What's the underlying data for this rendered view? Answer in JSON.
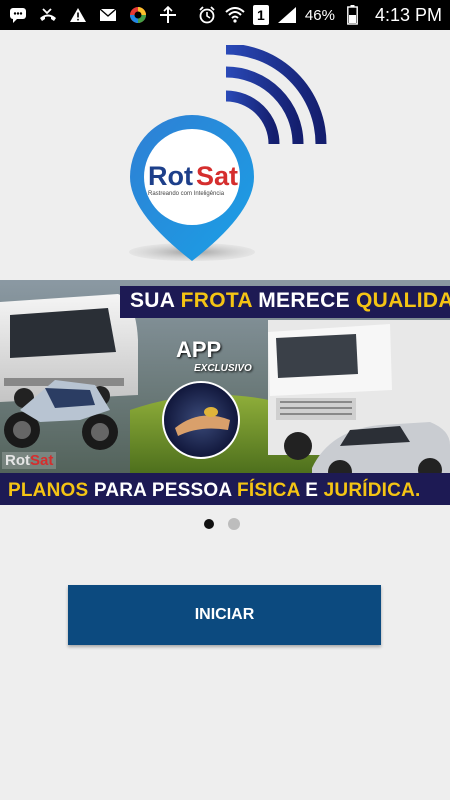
{
  "status_bar": {
    "battery_percent": "46%",
    "time": "4:13 PM",
    "sim_slot": "1",
    "icons": [
      "chat-icon",
      "missed-call-icon",
      "warning-icon",
      "mail-icon",
      "color-wheel-icon",
      "sync-icon",
      "alarm-icon",
      "wifi-icon",
      "sim-icon",
      "signal-icon",
      "battery-icon"
    ]
  },
  "logo": {
    "brand_part1": "Rot",
    "brand_part2": "Sat",
    "tagline": "Rastreando com Inteligência",
    "colors": {
      "pin": "#1f88d9",
      "waves": "#1b2a86",
      "text_dark": "#1d3f8a",
      "text_red": "#d52e2e"
    }
  },
  "banner": {
    "headline_part1": "SUA",
    "headline_part2": "FROTA",
    "headline_part3": "MERECE",
    "headline_part4": "QUALIDADE!",
    "app_label": "APP",
    "app_sub": "EXCLUSIVO",
    "footer_part1": "PLANOS",
    "footer_part2": "PARA PESSOA",
    "footer_part3": "FÍSICA",
    "footer_part4": "E",
    "footer_part5": "JURÍDICA.",
    "watermark_part1": "Rot",
    "watermark_part2": "Sat"
  },
  "carousel": {
    "pages": 2,
    "active": 1
  },
  "start_button": {
    "label": "INICIAR"
  }
}
